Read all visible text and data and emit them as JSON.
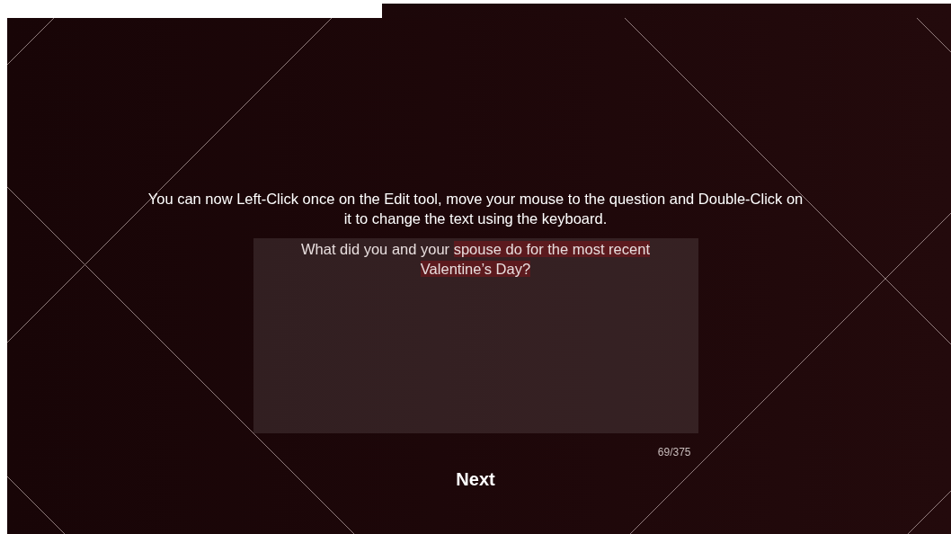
{
  "instruction": "You can now Left-Click once on the Edit tool, move your mouse to the question and Double-Click on it to change the text using the keyboard.",
  "question": {
    "segments": [
      {
        "text": "What did you and your ",
        "selected": false
      },
      {
        "text": "spouse do for the most recent Valentine’s Day?",
        "selected": true
      }
    ]
  },
  "counter": "69/375",
  "next_button": "Next"
}
